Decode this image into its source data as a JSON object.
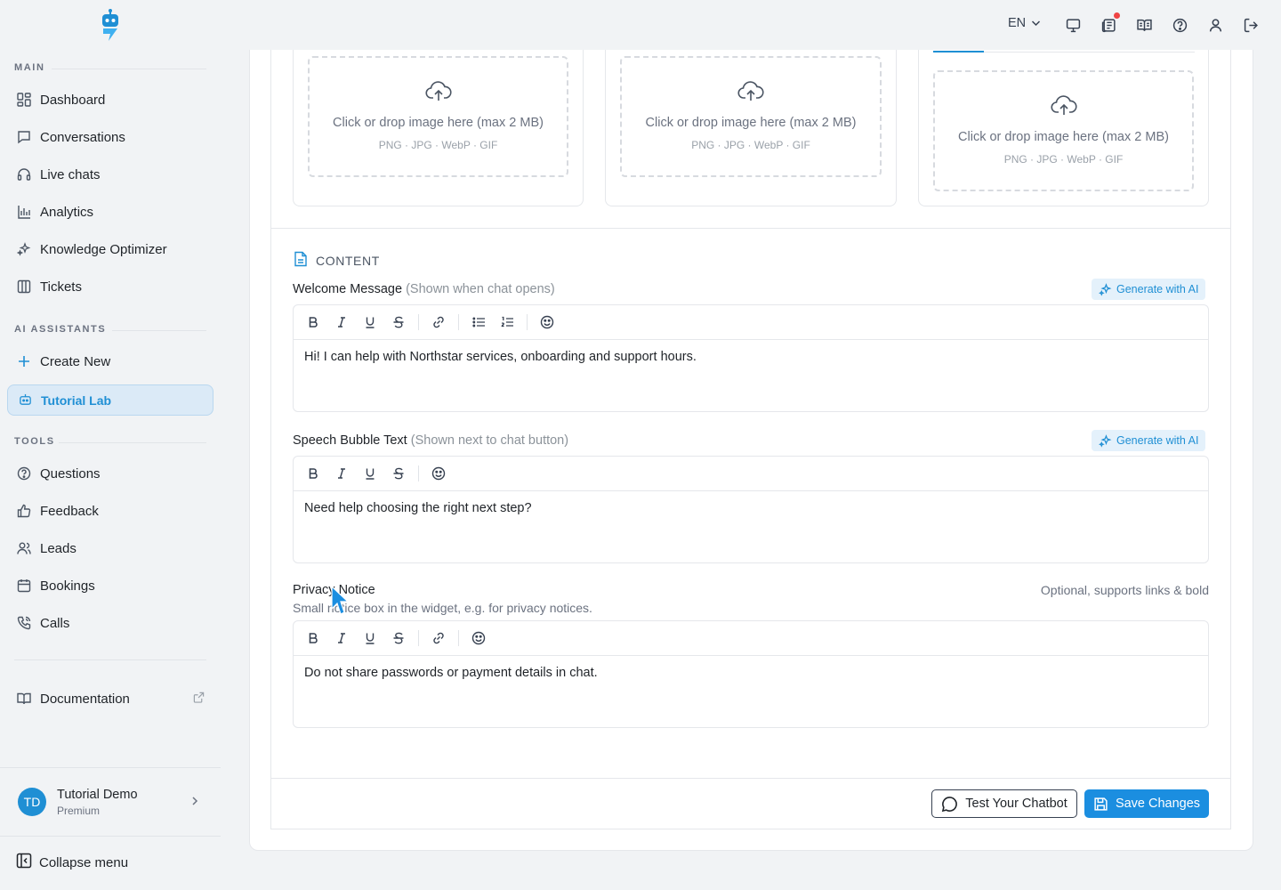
{
  "sidebar": {
    "sections": {
      "main": "MAIN",
      "ai_assistants": "AI ASSISTANTS",
      "tools": "TOOLS"
    },
    "main_items": [
      {
        "label": "Dashboard",
        "icon": "dashboard-icon"
      },
      {
        "label": "Conversations",
        "icon": "chat-bubble-icon"
      },
      {
        "label": "Live chats",
        "icon": "headset-icon"
      },
      {
        "label": "Analytics",
        "icon": "bar-chart-icon"
      },
      {
        "label": "Knowledge Optimizer",
        "icon": "sparkles-icon"
      },
      {
        "label": "Tickets",
        "icon": "columns-icon"
      }
    ],
    "assistant_items": [
      {
        "label": "Create New",
        "icon": "plus-icon"
      },
      {
        "label": "Tutorial Lab",
        "icon": "bot-icon",
        "active": true
      }
    ],
    "tool_items": [
      {
        "label": "Questions",
        "icon": "help-circle-icon"
      },
      {
        "label": "Feedback",
        "icon": "thumbs-up-icon"
      },
      {
        "label": "Leads",
        "icon": "users-icon"
      },
      {
        "label": "Bookings",
        "icon": "calendar-icon"
      },
      {
        "label": "Calls",
        "icon": "phone-icon"
      }
    ],
    "documentation": {
      "label": "Documentation",
      "icon": "book-icon"
    },
    "user": {
      "initials": "TD",
      "name": "Tutorial Demo",
      "plan": "Premium"
    },
    "collapse_label": "Collapse menu"
  },
  "topbar": {
    "language": "EN"
  },
  "image_uploads": [
    {
      "text": "Click or drop image here (max 2 MB)",
      "formats": "PNG · JPG · WebP · GIF"
    },
    {
      "text": "Click or drop image here (max 2 MB)",
      "formats": "PNG · JPG · WebP · GIF"
    },
    {
      "text": "Click or drop image here (max 2 MB)",
      "formats": "PNG · JPG · WebP · GIF"
    }
  ],
  "content": {
    "section_title": "CONTENT",
    "welcome": {
      "label": "Welcome Message",
      "hint": "(Shown when chat opens)",
      "ai_button": "Generate with AI",
      "value": "Hi! I can help with Northstar services, onboarding and support hours."
    },
    "speech_bubble": {
      "label": "Speech Bubble Text",
      "hint": "(Shown next to chat button)",
      "ai_button": "Generate with AI",
      "value": "Need help choosing the right next step?"
    },
    "privacy": {
      "label": "Privacy Notice",
      "help": "Small notice box in the widget, e.g. for privacy notices.",
      "right_hint": "Optional, supports links & bold",
      "value": "Do not share passwords or payment details in chat."
    }
  },
  "actions": {
    "test_label": "Test Your Chatbot",
    "save_label": "Save Changes"
  },
  "colors": {
    "accent": "#1f8fd4",
    "save_button": "#1b8ee0",
    "notification": "#ef4444"
  }
}
